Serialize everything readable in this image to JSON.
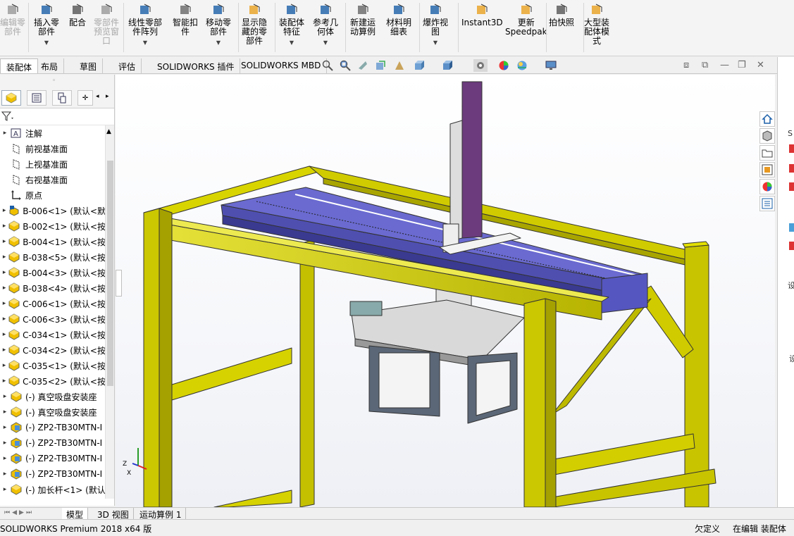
{
  "ribbon": {
    "buttons": [
      {
        "label": "编辑零\n部件",
        "icon": "edit-component-icon",
        "enabled": false
      },
      {
        "label": "插入零\n部件",
        "icon": "insert-component-icon",
        "enabled": true
      },
      {
        "label": "配合",
        "icon": "mate-icon",
        "enabled": true
      },
      {
        "label": "零部件\n预览窗\n口",
        "icon": "component-preview-icon",
        "enabled": false
      },
      {
        "label": "线性零部\n件阵列",
        "icon": "linear-pattern-icon",
        "enabled": true
      },
      {
        "label": "智能扣\n件",
        "icon": "smart-fasteners-icon",
        "enabled": true
      },
      {
        "label": "移动零\n部件",
        "icon": "move-component-icon",
        "enabled": true
      },
      {
        "label": "显示隐\n藏的零\n部件",
        "icon": "show-hidden-icon",
        "enabled": true
      },
      {
        "label": "装配体\n特征",
        "icon": "assembly-features-icon",
        "enabled": true
      },
      {
        "label": "参考几\n何体",
        "icon": "reference-geometry-icon",
        "enabled": true
      },
      {
        "label": "新建运\n动算例",
        "icon": "motion-study-icon",
        "enabled": true
      },
      {
        "label": "材料明\n细表",
        "icon": "bom-icon",
        "enabled": true
      },
      {
        "label": "爆炸视\n图",
        "icon": "exploded-view-icon",
        "enabled": true
      },
      {
        "label": "Instant3D",
        "icon": "instant3d-icon",
        "enabled": true
      },
      {
        "label": "更新\nSpeedpak",
        "icon": "speedpak-icon",
        "enabled": true
      },
      {
        "label": "拍快照",
        "icon": "snapshot-icon",
        "enabled": true
      },
      {
        "label": "大型装\n配体模\n式",
        "icon": "large-assembly-icon",
        "enabled": true
      }
    ]
  },
  "command_tabs": [
    "装配体",
    "布局",
    "草图",
    "评估",
    "SOLIDWORKS 插件",
    "SOLIDWORKS MBD"
  ],
  "tree": {
    "items": [
      {
        "label": "注解",
        "icon": "annotation-icon",
        "expandable": true
      },
      {
        "label": "前视基准面",
        "icon": "plane-icon",
        "expandable": false
      },
      {
        "label": "上视基准面",
        "icon": "plane-icon",
        "expandable": false
      },
      {
        "label": "右视基准面",
        "icon": "plane-icon",
        "expandable": false
      },
      {
        "label": "原点",
        "icon": "origin-icon",
        "expandable": false
      },
      {
        "label": "B-006<1> (默认<默",
        "icon": "subassembly-icon",
        "expandable": true
      },
      {
        "label": "B-002<1> (默认<按",
        "icon": "part-icon",
        "expandable": true
      },
      {
        "label": "B-004<1> (默认<按",
        "icon": "part-icon",
        "expandable": true
      },
      {
        "label": "B-038<5> (默认<按",
        "icon": "part-icon",
        "expandable": true
      },
      {
        "label": "B-004<3> (默认<按",
        "icon": "part-icon",
        "expandable": true
      },
      {
        "label": "B-038<4> (默认<按",
        "icon": "part-icon",
        "expandable": true
      },
      {
        "label": "C-006<1> (默认<按",
        "icon": "part-icon",
        "expandable": true
      },
      {
        "label": "C-006<3> (默认<按",
        "icon": "part-icon",
        "expandable": true
      },
      {
        "label": "C-034<1> (默认<按",
        "icon": "part-icon",
        "expandable": true
      },
      {
        "label": "C-034<2> (默认<按",
        "icon": "part-icon",
        "expandable": true
      },
      {
        "label": "C-035<1> (默认<按",
        "icon": "part-icon",
        "expandable": true
      },
      {
        "label": "C-035<2> (默认<按",
        "icon": "part-icon",
        "expandable": true
      },
      {
        "label": "(-) 真空吸盘安装座",
        "icon": "part-icon",
        "expandable": true
      },
      {
        "label": "(-) 真空吸盘安装座",
        "icon": "part-icon",
        "expandable": true
      },
      {
        "label": "(-) ZP2-TB30MTN-I",
        "icon": "subassembly-blue-icon",
        "expandable": true
      },
      {
        "label": "(-) ZP2-TB30MTN-I",
        "icon": "subassembly-blue-icon",
        "expandable": true
      },
      {
        "label": "(-) ZP2-TB30MTN-I",
        "icon": "subassembly-blue-icon",
        "expandable": true
      },
      {
        "label": "(-) ZP2-TB30MTN-I",
        "icon": "subassembly-blue-icon",
        "expandable": true
      },
      {
        "label": "(-) 加长杆<1> (默认",
        "icon": "part-icon",
        "expandable": true
      }
    ]
  },
  "bottom_tabs": [
    "模型",
    "3D 视图",
    "运动算例 1"
  ],
  "status": {
    "product": "SOLIDWORKS Premium 2018 x64 版",
    "underdefined": "欠定义",
    "mode": "在编辑 装配体"
  },
  "right_pane_letters": [
    "S",
    "S",
    "设",
    "设"
  ],
  "colors": {
    "frame": "#c8c400",
    "beam": "#5a5ab4",
    "column": "#6b3b7d"
  }
}
